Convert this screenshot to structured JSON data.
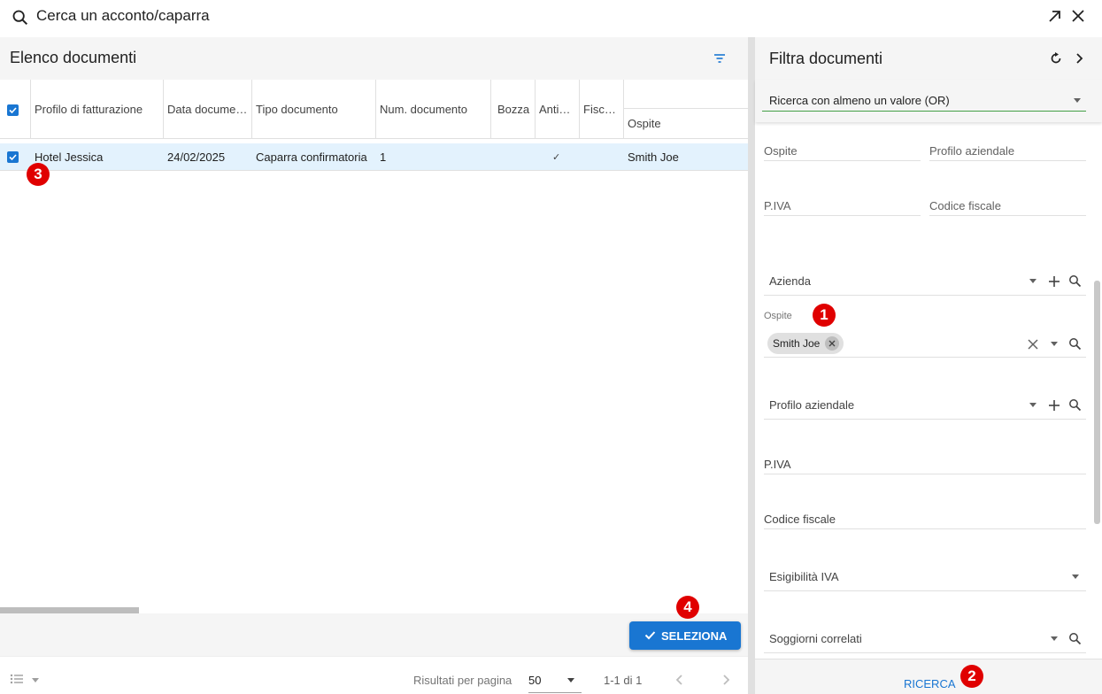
{
  "dialog": {
    "title": "Cerca un acconto/caparra",
    "search_icon": "search-icon",
    "expand_icon": "expand-icon",
    "close_icon": "close-icon"
  },
  "documents": {
    "title": "Elenco documenti",
    "filter_icon": "filter-icon",
    "columns": [
      "Profilo di fatturazione",
      "Data documento",
      "Tipo documento",
      "Num. documento",
      "Bozza",
      "Anticipo",
      "Fiscale"
    ],
    "group_column": "Ospite",
    "rows": [
      {
        "selected": true,
        "profilo": "Hotel Jessica",
        "data": "24/02/2025",
        "tipo": "Caparra confirmatoria",
        "numero": "1",
        "bozza": "",
        "anticipo": "✓",
        "fiscale": "",
        "ospite": "Smith Joe"
      }
    ],
    "select_button": "SELEZIONA",
    "pager": {
      "results_label": "Risultati per pagina",
      "page_size": "50",
      "range": "1-1 di 1"
    }
  },
  "filters": {
    "title": "Filtra documenti",
    "mode": "Ricerca con almeno un valore (OR)",
    "quick": {
      "ospite": "Ospite",
      "profilo_aziendale": "Profilo aziendale",
      "piva": "P.IVA",
      "codice_fiscale": "Codice fiscale"
    },
    "azienda": "Azienda",
    "ospite_label": "Ospite",
    "ospite_chip": "Smith Joe",
    "profilo_aziendale": "Profilo aziendale",
    "piva": "P.IVA",
    "codice_fiscale": "Codice fiscale",
    "esigibilita_iva": "Esigibilità IVA",
    "soggiorni_correlati": "Soggiorni correlati",
    "search_button": "RICERCA"
  },
  "annotations": [
    "1",
    "2",
    "3",
    "4"
  ],
  "colors": {
    "primary": "#1976d2",
    "badge": "#e00000",
    "selected_row": "#e3f2fd",
    "active_underline": "#43a047"
  }
}
